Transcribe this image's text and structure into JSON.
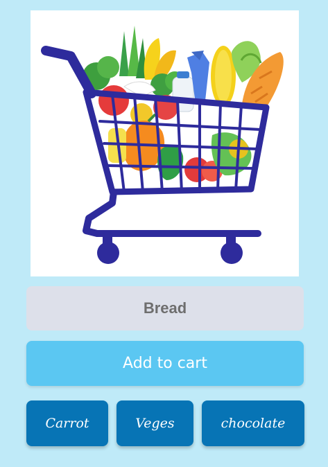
{
  "product": {
    "image_icon": "shopping-cart-with-groceries",
    "name_value": "Bread"
  },
  "actions": {
    "add_to_cart_label": "Add to cart"
  },
  "suggestions": [
    {
      "label": "Carrot"
    },
    {
      "label": "Veges"
    },
    {
      "label": "chocolate"
    }
  ],
  "colors": {
    "background": "#bfeaf8",
    "field_background": "#dde0ea",
    "primary_button": "#5bc7f2",
    "chip_button": "#0774b5",
    "cart_frame": "#2e2b9c"
  }
}
